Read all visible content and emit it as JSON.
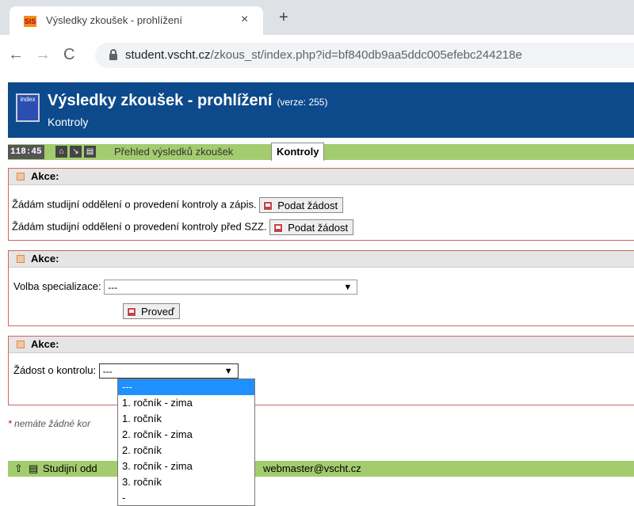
{
  "browser": {
    "tab_title": "Výsledky zkoušek - prohlížení",
    "favicon_text": "SIS",
    "close_glyph": "×",
    "new_tab_glyph": "+",
    "url_host": "student.vscht.cz",
    "url_path": "/zkous_st/index.php?id=bf840db9aa5ddc005efebc244218e",
    "back_glyph": "←",
    "forward_glyph": "→",
    "reload_glyph": "C"
  },
  "header": {
    "logo_text": "index",
    "title": "Výsledky zkoušek - prohlížení",
    "version": "(verze: 255)",
    "subtitle": "Kontroly"
  },
  "tabstrip": {
    "clock": "118:45",
    "tab_overview": "Přehled výsledků zkoušek",
    "tab_active": "Kontroly"
  },
  "panels": {
    "actions_title": "Akce:",
    "request1_text": "Žádám studijní oddělení o provedení kontroly a zápis.",
    "request2_text": "Žádám studijní oddělení o provedení kontroly před SZZ.",
    "submit_label": "Podat žádost",
    "specialization_label": "Volba specializace:",
    "specialization_value": "---",
    "execute_label": "Proveď",
    "control_label": "Žádost o kontrolu:",
    "control_value": "---"
  },
  "dropdown_options": [
    "---",
    "1. ročník - zima",
    "1. ročník",
    "2. ročník - zima",
    "2. ročník",
    "3. ročník - zima",
    "3. ročník",
    "-"
  ],
  "note": {
    "star": "*",
    "text": "nemáte žádné kor"
  },
  "footer": {
    "dept": "Studijní odd",
    "email": "webmaster@vscht.cz"
  },
  "colors": {
    "header_bg": "#0d4a8c",
    "tabstrip_bg": "#a3cc6e",
    "panel_border": "#cc6666",
    "selected_option": "#1e90ff"
  }
}
